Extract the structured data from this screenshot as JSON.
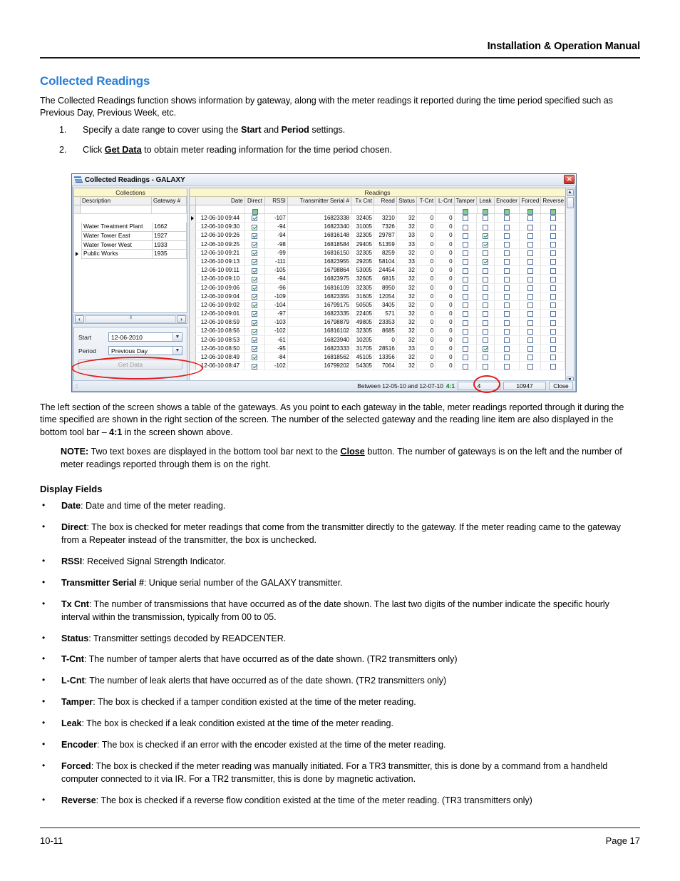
{
  "header": {
    "title": "Installation & Operation Manual"
  },
  "footer": {
    "left": "10-11",
    "right": "Page 17"
  },
  "section": {
    "title": "Collected Readings",
    "intro": "The Collected Readings function shows information by gateway, along with the meter readings it reported during the time period specified such as Previous Day, Previous Week, etc."
  },
  "steps": [
    {
      "num": "1.",
      "pre": "Specify a date range to cover using the ",
      "b1": "Start",
      "mid": " and ",
      "b2": "Period",
      "post": " settings."
    },
    {
      "num": "2.",
      "pre": "Click ",
      "b1": "Get Data",
      "post": " to obtain meter reading information for the time period chosen."
    }
  ],
  "after_shot": {
    "p1_a": "The left section of the screen shows a table of the gateways. As you point to each gateway in the table, meter readings reported through it during the time specified are shown in the right section of the screen. The number of the selected gateway and the reading line item are also displayed in the bottom tool bar – ",
    "p1_b": "4:1",
    "p1_c": " in the screen shown above.",
    "note_label": "NOTE:",
    "note_a": " Two text boxes are displayed in the bottom tool bar next to the ",
    "note_b": "Close",
    "note_c": " button. The number of gateways is on the left and the number of meter readings reported through them is on the right."
  },
  "display_fields": {
    "heading": "Display Fields",
    "items": [
      {
        "term": "Date",
        "desc": ": Date and time of the meter reading."
      },
      {
        "term": "Direct",
        "desc": ": The box is checked for meter readings that come from the transmitter directly to the gateway. If the meter reading came to the gateway from a Repeater instead of the transmitter, the box is unchecked."
      },
      {
        "term": "RSSI",
        "desc": ": Received Signal Strength Indicator."
      },
      {
        "term": "Transmitter Serial #",
        "desc": ": Unique serial number of the GALAXY transmitter."
      },
      {
        "term": "Tx Cnt",
        "desc": ": The number of transmissions that have occurred as of the date shown. The last two digits of the number indicate the specific hourly interval within the transmission, typically from 00 to 05."
      },
      {
        "term": "Status",
        "desc": ": Transmitter settings decoded by READCENTER."
      },
      {
        "term": "T-Cnt",
        "desc": ": The number of tamper alerts that have occurred as of the date shown. (TR2 transmitters only)"
      },
      {
        "term": "L-Cnt",
        "desc": ": The number of leak alerts that have occurred as of the date shown. (TR2 transmitters only)"
      },
      {
        "term": "Tamper",
        "desc": ": The box is checked if a tamper condition existed at the time of the meter reading."
      },
      {
        "term": "Leak",
        "desc": ": The box is checked if a leak condition existed at the time of the meter reading."
      },
      {
        "term": "Encoder",
        "desc": ": The box is checked if an error with the encoder existed at the time of the meter reading."
      },
      {
        "term": "Forced",
        "desc": ": The box is checked if the meter reading was manually initiated. For a TR3 transmitter, this is done by a command from a handheld computer connected to it via IR. For a TR2 transmitter, this is done by magnetic activation."
      },
      {
        "term": "Reverse",
        "desc": ": The box is checked if a reverse flow condition existed at the time of the meter reading. (TR3 transmitters only)"
      }
    ]
  },
  "app": {
    "title": "Collected Readings - GALAXY",
    "close_glyph": "✕",
    "left_pane": {
      "caption": "Collections",
      "columns": [
        "Description",
        "Gateway #"
      ],
      "rows": [
        {
          "description": "Water Treatment Plant",
          "gateway": "1662",
          "current": false
        },
        {
          "description": "Water Tower East",
          "gateway": "1927",
          "current": false
        },
        {
          "description": "Water Tower West",
          "gateway": "1933",
          "current": false
        },
        {
          "description": "Public Works",
          "gateway": "1935",
          "current": true
        }
      ]
    },
    "controls": {
      "start_label": "Start",
      "start_value": "12-06-2010",
      "period_label": "Period",
      "period_value": "Previous Day",
      "get_data_label": "Get Data"
    },
    "readings": {
      "caption": "Readings",
      "columns": [
        "Date",
        "Direct",
        "RSSI",
        "Transmitter Serial #",
        "Tx Cnt",
        "Read",
        "Status",
        "T-Cnt",
        "L-Cnt",
        "Tamper",
        "Leak",
        "Encoder",
        "Forced",
        "Reverse"
      ],
      "rows": [
        {
          "date": "12-06-10 09:44",
          "direct": true,
          "rssi": "-107",
          "serial": "16823338",
          "tx": "32405",
          "read": "3210",
          "status": "32",
          "tcnt": "0",
          "lcnt": "0",
          "tamper": false,
          "leak": false,
          "encoder": false,
          "forced": false,
          "reverse": false,
          "current": true
        },
        {
          "date": "12-06-10 09:30",
          "direct": true,
          "rssi": "-94",
          "serial": "16823340",
          "tx": "31005",
          "read": "7326",
          "status": "32",
          "tcnt": "0",
          "lcnt": "0",
          "tamper": false,
          "leak": false,
          "encoder": false,
          "forced": false,
          "reverse": false,
          "current": false
        },
        {
          "date": "12-06-10 09:26",
          "direct": true,
          "rssi": "-94",
          "serial": "16816148",
          "tx": "32305",
          "read": "29787",
          "status": "33",
          "tcnt": "0",
          "lcnt": "0",
          "tamper": false,
          "leak": true,
          "encoder": false,
          "forced": false,
          "reverse": false,
          "current": false
        },
        {
          "date": "12-06-10 09:25",
          "direct": true,
          "rssi": "-98",
          "serial": "16818584",
          "tx": "29405",
          "read": "51359",
          "status": "33",
          "tcnt": "0",
          "lcnt": "0",
          "tamper": false,
          "leak": true,
          "encoder": false,
          "forced": false,
          "reverse": false,
          "current": false
        },
        {
          "date": "12-06-10 09:21",
          "direct": true,
          "rssi": "-99",
          "serial": "16816150",
          "tx": "32305",
          "read": "8259",
          "status": "32",
          "tcnt": "0",
          "lcnt": "0",
          "tamper": false,
          "leak": false,
          "encoder": false,
          "forced": false,
          "reverse": false,
          "current": false
        },
        {
          "date": "12-06-10 09:13",
          "direct": true,
          "rssi": "-111",
          "serial": "16823955",
          "tx": "29205",
          "read": "58104",
          "status": "33",
          "tcnt": "0",
          "lcnt": "0",
          "tamper": false,
          "leak": true,
          "encoder": false,
          "forced": false,
          "reverse": false,
          "current": false
        },
        {
          "date": "12-06-10 09:11",
          "direct": true,
          "rssi": "-105",
          "serial": "16798864",
          "tx": "53005",
          "read": "24454",
          "status": "32",
          "tcnt": "0",
          "lcnt": "0",
          "tamper": false,
          "leak": false,
          "encoder": false,
          "forced": false,
          "reverse": false,
          "current": false
        },
        {
          "date": "12-06-10 09:10",
          "direct": true,
          "rssi": "-94",
          "serial": "16823975",
          "tx": "32605",
          "read": "6815",
          "status": "32",
          "tcnt": "0",
          "lcnt": "0",
          "tamper": false,
          "leak": false,
          "encoder": false,
          "forced": false,
          "reverse": false,
          "current": false
        },
        {
          "date": "12-06-10 09:06",
          "direct": true,
          "rssi": "-96",
          "serial": "16816109",
          "tx": "32305",
          "read": "8950",
          "status": "32",
          "tcnt": "0",
          "lcnt": "0",
          "tamper": false,
          "leak": false,
          "encoder": false,
          "forced": false,
          "reverse": false,
          "current": false
        },
        {
          "date": "12-06-10 09:04",
          "direct": true,
          "rssi": "-109",
          "serial": "16823355",
          "tx": "31605",
          "read": "12054",
          "status": "32",
          "tcnt": "0",
          "lcnt": "0",
          "tamper": false,
          "leak": false,
          "encoder": false,
          "forced": false,
          "reverse": false,
          "current": false
        },
        {
          "date": "12-06-10 09:02",
          "direct": true,
          "rssi": "-104",
          "serial": "16799175",
          "tx": "50505",
          "read": "3405",
          "status": "32",
          "tcnt": "0",
          "lcnt": "0",
          "tamper": false,
          "leak": false,
          "encoder": false,
          "forced": false,
          "reverse": false,
          "current": false
        },
        {
          "date": "12-06-10 09:01",
          "direct": true,
          "rssi": "-97",
          "serial": "16823335",
          "tx": "22405",
          "read": "571",
          "status": "32",
          "tcnt": "0",
          "lcnt": "0",
          "tamper": false,
          "leak": false,
          "encoder": false,
          "forced": false,
          "reverse": false,
          "current": false
        },
        {
          "date": "12-06-10 08:59",
          "direct": true,
          "rssi": "-103",
          "serial": "16798879",
          "tx": "49805",
          "read": "23353",
          "status": "32",
          "tcnt": "0",
          "lcnt": "0",
          "tamper": false,
          "leak": false,
          "encoder": false,
          "forced": false,
          "reverse": false,
          "current": false
        },
        {
          "date": "12-06-10 08:56",
          "direct": true,
          "rssi": "-102",
          "serial": "16816102",
          "tx": "32305",
          "read": "8685",
          "status": "32",
          "tcnt": "0",
          "lcnt": "0",
          "tamper": false,
          "leak": false,
          "encoder": false,
          "forced": false,
          "reverse": false,
          "current": false
        },
        {
          "date": "12-06-10 08:53",
          "direct": true,
          "rssi": "-61",
          "serial": "16823940",
          "tx": "10205",
          "read": "0",
          "status": "32",
          "tcnt": "0",
          "lcnt": "0",
          "tamper": false,
          "leak": false,
          "encoder": false,
          "forced": false,
          "reverse": false,
          "current": false
        },
        {
          "date": "12-06-10 08:50",
          "direct": true,
          "rssi": "-95",
          "serial": "16823333",
          "tx": "31705",
          "read": "28516",
          "status": "33",
          "tcnt": "0",
          "lcnt": "0",
          "tamper": false,
          "leak": true,
          "encoder": false,
          "forced": false,
          "reverse": false,
          "current": false
        },
        {
          "date": "12-06-10 08:49",
          "direct": true,
          "rssi": "-84",
          "serial": "16818562",
          "tx": "45105",
          "read": "13356",
          "status": "32",
          "tcnt": "0",
          "lcnt": "0",
          "tamper": false,
          "leak": false,
          "encoder": false,
          "forced": false,
          "reverse": false,
          "current": false
        },
        {
          "date": "12-06-10 08:47",
          "direct": true,
          "rssi": "-102",
          "serial": "16799202",
          "tx": "54305",
          "read": "7064",
          "status": "32",
          "tcnt": "0",
          "lcnt": "0",
          "tamper": false,
          "leak": false,
          "encoder": false,
          "forced": false,
          "reverse": false,
          "current": false
        }
      ]
    },
    "statusbar": {
      "range_text": "Between 12-05-10 and 12-07-10",
      "ratio": "4:1",
      "gateway_count": "4",
      "reading_count": "10947",
      "close_label": "Close"
    }
  }
}
